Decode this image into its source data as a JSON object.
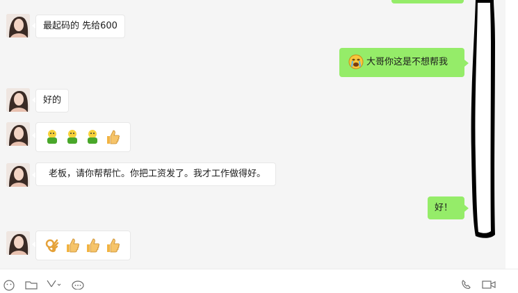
{
  "messages": [
    {
      "side": "out",
      "text": ""
    },
    {
      "side": "in",
      "text": "最起码的 先给600"
    },
    {
      "side": "out",
      "emoji": "crying-face",
      "text": "大哥你这是不想帮我"
    },
    {
      "side": "in",
      "text": "好的"
    },
    {
      "side": "in",
      "emojis": [
        "green-figure",
        "green-figure",
        "green-figure",
        "thumbs-up"
      ]
    },
    {
      "side": "in",
      "text": "老板，请你帮帮忙。你把工资发了。我才工作做得好。"
    },
    {
      "side": "out",
      "text": "好！"
    },
    {
      "side": "in",
      "emojis": [
        "ok-hand",
        "thumbs-up",
        "thumbs-up",
        "thumbs-up"
      ]
    }
  ],
  "colors": {
    "chat_bg": "#f5f5f5",
    "out_bubble": "#95ec69",
    "in_bubble": "#ffffff"
  },
  "toolbar_icons": [
    "emoji-icon",
    "folder-icon",
    "scissors-icon",
    "chat-history-icon",
    "phone-icon",
    "video-call-icon"
  ]
}
